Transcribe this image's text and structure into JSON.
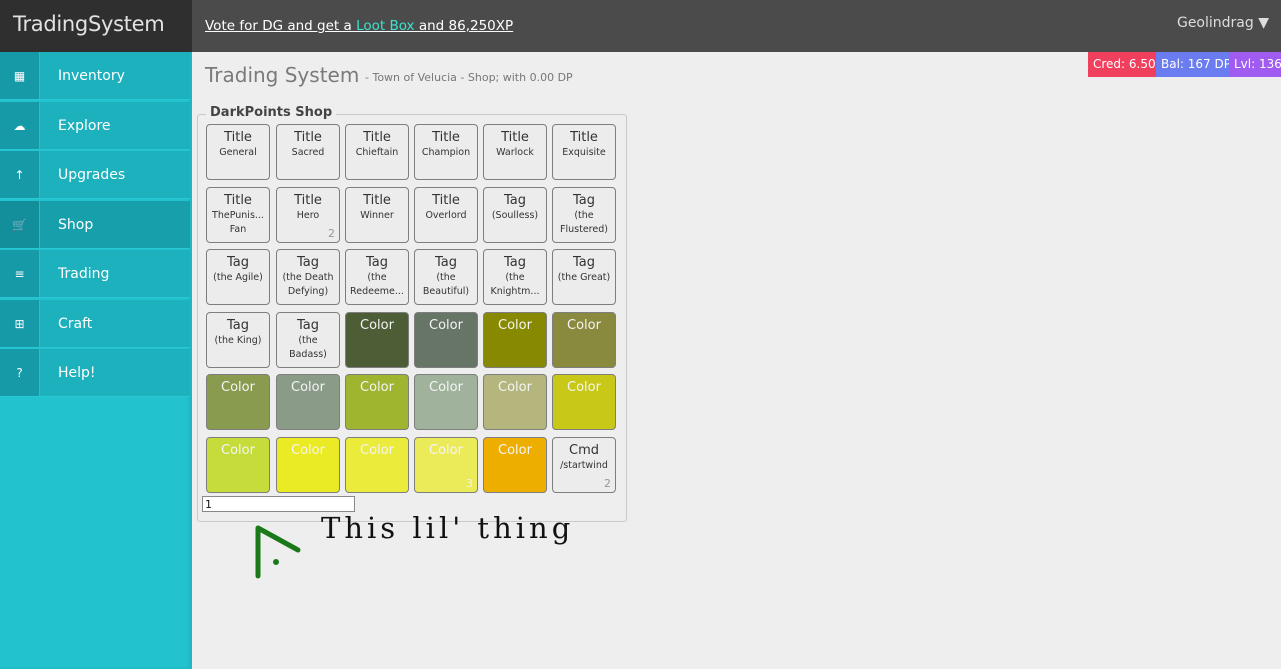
{
  "brand": "TradingSystem",
  "promo": {
    "pre": "Vote for DG and get a ",
    "link": "Loot Box",
    "post": " and 86,250XP"
  },
  "user": {
    "name": "Geolindrag",
    "caret": "▼"
  },
  "sidebar": {
    "items": [
      {
        "label": "Inventory",
        "icon": "grid-icon",
        "glyph": "▦"
      },
      {
        "label": "Explore",
        "icon": "cloud-icon",
        "glyph": "☁"
      },
      {
        "label": "Upgrades",
        "icon": "arrow-up-icon",
        "glyph": "↑"
      },
      {
        "label": "Shop",
        "icon": "cart-icon",
        "glyph": "🛒",
        "active": true
      },
      {
        "label": "Trading",
        "icon": "list-icon",
        "glyph": "≡"
      },
      {
        "label": "Craft",
        "icon": "plus-square-icon",
        "glyph": "⊞"
      },
      {
        "label": "Help!",
        "icon": "question-icon",
        "glyph": "?"
      }
    ]
  },
  "stats": {
    "cred": "Cred: 6.50",
    "bal": "Bal: 167 DP",
    "lvl": "Lvl: 136"
  },
  "page": {
    "title": "Trading System",
    "subtitle": "- Town of Velucia - Shop; with 0.00 DP"
  },
  "shop": {
    "legend": "DarkPoints Shop",
    "tiles": [
      {
        "type": "Title",
        "name": "General"
      },
      {
        "type": "Title",
        "name": "Sacred"
      },
      {
        "type": "Title",
        "name": "Chieftain"
      },
      {
        "type": "Title",
        "name": "Champion"
      },
      {
        "type": "Title",
        "name": "Warlock"
      },
      {
        "type": "Title",
        "name": "Exquisite"
      },
      {
        "type": "Title",
        "name": "ThePunis... Fan"
      },
      {
        "type": "Title",
        "name": "Hero",
        "count": "2"
      },
      {
        "type": "Title",
        "name": "Winner"
      },
      {
        "type": "Title",
        "name": "Overlord"
      },
      {
        "type": "Tag",
        "name": "(Soulless)"
      },
      {
        "type": "Tag",
        "name": "(the Flustered)"
      },
      {
        "type": "Tag",
        "name": "(the Agile)"
      },
      {
        "type": "Tag",
        "name": "(the Death Defying)"
      },
      {
        "type": "Tag",
        "name": "(the Redeeme..."
      },
      {
        "type": "Tag",
        "name": "(the Beautiful)"
      },
      {
        "type": "Tag",
        "name": "(the Knightm..."
      },
      {
        "type": "Tag",
        "name": "(the Great)"
      },
      {
        "type": "Tag",
        "name": "(the King)"
      },
      {
        "type": "Tag",
        "name": "(the Badass)"
      },
      {
        "type": "Color",
        "color": "#4d5e37"
      },
      {
        "type": "Color",
        "color": "#667566"
      },
      {
        "type": "Color",
        "color": "#878a00"
      },
      {
        "type": "Color",
        "color": "#898a3e"
      },
      {
        "type": "Color",
        "color": "#889b4e"
      },
      {
        "type": "Color",
        "color": "#8a9c88"
      },
      {
        "type": "Color",
        "color": "#9fb530"
      },
      {
        "type": "Color",
        "color": "#a0b29c"
      },
      {
        "type": "Color",
        "color": "#b5b57e"
      },
      {
        "type": "Color",
        "color": "#c8c818"
      },
      {
        "type": "Color",
        "color": "#c6dc3a"
      },
      {
        "type": "Color",
        "color": "#eaea25"
      },
      {
        "type": "Color",
        "color": "#ebeb3c"
      },
      {
        "type": "Color",
        "color": "#ebeb5a",
        "count": "3"
      },
      {
        "type": "Color",
        "color": "#edae00"
      },
      {
        "type": "Cmd",
        "name": "/startwind",
        "count": "2"
      }
    ],
    "quantity": "1"
  },
  "annotation": {
    "text": "This lil' thing",
    "color": "#1a7a1a"
  }
}
